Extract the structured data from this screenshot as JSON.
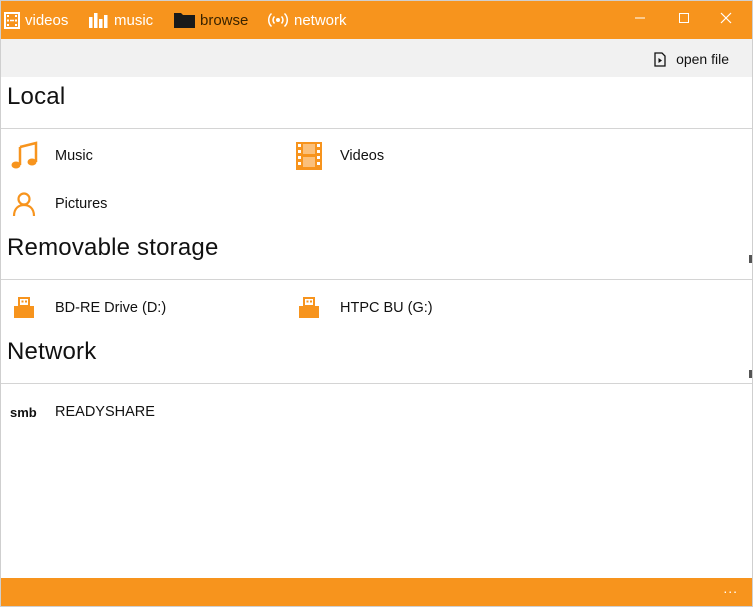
{
  "nav": {
    "items": [
      {
        "label": "videos",
        "icon": "film-icon"
      },
      {
        "label": "music",
        "icon": "equalizer-icon"
      },
      {
        "label": "browse",
        "icon": "folder-icon"
      },
      {
        "label": "network",
        "icon": "broadcast-icon"
      }
    ],
    "active": "browse",
    "accent": "#f7941d"
  },
  "window_controls": [
    "minimize",
    "maximize",
    "close"
  ],
  "command_bar": {
    "open_file": "open file"
  },
  "sections": {
    "local": {
      "title": "Local",
      "items": [
        {
          "label": "Music",
          "icon": "music-note-icon"
        },
        {
          "label": "Videos",
          "icon": "film-strip-icon"
        },
        {
          "label": "Pictures",
          "icon": "person-icon"
        }
      ]
    },
    "removable": {
      "title": "Removable storage",
      "items": [
        {
          "label": "BD-RE Drive (D:)",
          "icon": "usb-drive-icon"
        },
        {
          "label": "HTPC BU (G:)",
          "icon": "usb-drive-icon"
        }
      ]
    },
    "network": {
      "title": "Network",
      "items": [
        {
          "label": "READYSHARE",
          "badge": "smb"
        }
      ]
    }
  },
  "bottom_bar": {
    "more": "..."
  }
}
